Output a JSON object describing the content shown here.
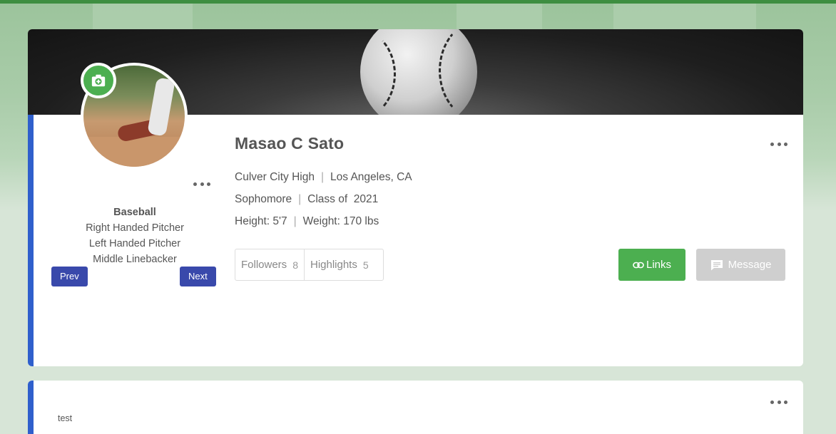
{
  "colors": {
    "accent_blue": "#2f5fcc",
    "green": "#4caf50",
    "nav_button": "#3949ab",
    "message_disabled": "#cfcfcf"
  },
  "profile": {
    "name": "Masao C Sato",
    "school": "Culver City High",
    "location": "Los Angeles, CA",
    "grade": "Sophomore",
    "class_label": "Class of  2021",
    "height": "Height: 5'7",
    "weight": "Weight: 170 lbs",
    "separator": "|"
  },
  "positions": {
    "sport": "Baseball",
    "items": [
      "Right Handed Pitcher",
      "Left Handed Pitcher",
      "Middle Linebacker"
    ]
  },
  "nav": {
    "prev": "Prev",
    "next": "Next"
  },
  "stats": [
    {
      "label": "Followers",
      "count": "8"
    },
    {
      "label": "Highlights",
      "count": "5"
    }
  ],
  "actions": {
    "links": "Links",
    "message": "Message"
  },
  "icons": {
    "camera": "camera-add-icon",
    "more": "more-horizontal-icon",
    "link": "link-icon",
    "message": "message-icon"
  },
  "post": {
    "text": "test"
  }
}
